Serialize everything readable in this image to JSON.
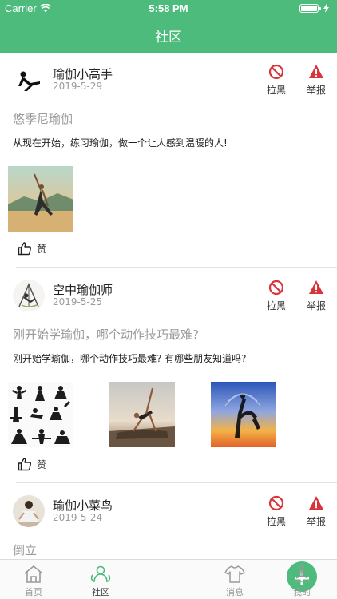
{
  "status_bar": {
    "carrier": "Carrier",
    "time": "5:58 PM"
  },
  "nav": {
    "title": "社区"
  },
  "colors": {
    "brand": "#4dbb7c",
    "block": "#d9343a",
    "report": "#d9343a"
  },
  "post_actions": {
    "block_label": "拉黑",
    "report_label": "举报",
    "like_label": "赞"
  },
  "posts": [
    {
      "username": "瑜伽小高手",
      "date": "2019-5-29",
      "title": "悠季尼瑜伽",
      "body": "从现在开始，练习瑜伽，做一个让人感到温暖的人!"
    },
    {
      "username": "空中瑜伽师",
      "date": "2019-5-25",
      "title": "刚开始学瑜伽，哪个动作技巧最难?",
      "body": "刚开始学瑜伽，哪个动作技巧最难? 有哪些朋友知道吗?"
    },
    {
      "username": "瑜伽小菜鸟",
      "date": "2019-5-24",
      "title": "倒立",
      "body": ""
    }
  ],
  "tabs": [
    {
      "label": "首页",
      "icon": "house-icon"
    },
    {
      "label": "社区",
      "icon": "community-icon"
    },
    {
      "label": "",
      "icon": "plus-icon"
    },
    {
      "label": "消息",
      "icon": "tshirt-icon"
    },
    {
      "label": "我的",
      "icon": "meditation-icon"
    }
  ]
}
